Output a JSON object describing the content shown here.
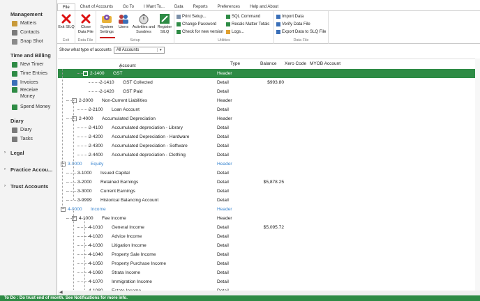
{
  "sidebar": {
    "sections": [
      {
        "title": "Management",
        "expanded": true,
        "items": [
          {
            "label": "Matters",
            "icon": "folder-icon"
          },
          {
            "label": "Contacts",
            "icon": "contacts-icon"
          },
          {
            "label": "Snap Shot",
            "icon": "camera-icon"
          }
        ]
      },
      {
        "title": "Time and Billing",
        "expanded": true,
        "items": [
          {
            "label": "New Timer",
            "icon": "timer-icon"
          },
          {
            "label": "Time Entries",
            "icon": "clock-icon"
          },
          {
            "label": "Invoices",
            "icon": "invoice-icon"
          },
          {
            "label": "Receive Money",
            "icon": "receive-money-icon"
          },
          {
            "label": "Spend Money",
            "icon": "spend-money-icon"
          }
        ]
      },
      {
        "title": "Diary",
        "expanded": true,
        "items": [
          {
            "label": "Diary",
            "icon": "diary-icon"
          },
          {
            "label": "Tasks",
            "icon": "tasks-icon"
          }
        ]
      },
      {
        "title": "Legal",
        "expanded": false,
        "items": []
      },
      {
        "title": "Practice Accou...",
        "expanded": false,
        "items": []
      },
      {
        "title": "Trust Accounts",
        "expanded": false,
        "items": []
      }
    ]
  },
  "ribbon": {
    "tabs": [
      "File",
      "Chart of Accounts",
      "Go To",
      "I Want To...",
      "Data",
      "Reports",
      "Preferences",
      "Help and About"
    ],
    "active_tab": "File",
    "groups": {
      "exit": {
        "label": "Exit",
        "button": "Exit SILQ"
      },
      "data_file": {
        "label": "Data File",
        "button": "Close Data File"
      },
      "setup": {
        "label": "Setup",
        "buttons": [
          "System Settings",
          "Users",
          "Activities and Sundries",
          "Register SILQ"
        ]
      },
      "utilities": {
        "label": "Utilities",
        "buttons": [
          "Print Setup...",
          "Change Password",
          "Check for new version",
          "SQL Command",
          "Recalc Matter Totals",
          "Logs..."
        ]
      },
      "data_file2": {
        "label": "Data File",
        "buttons": [
          "Import Data",
          "Verify Data File",
          "Export Data to SLQ File"
        ]
      }
    }
  },
  "filter": {
    "label": "Show what type of accounts",
    "selected": "All Accounts"
  },
  "table": {
    "columns": [
      "Account Name",
      "Type",
      "Balance",
      "Xero Code",
      "MYOB Account"
    ],
    "rows": [
      {
        "code": "2-1400",
        "name": "GST",
        "type": "Header",
        "balance": "",
        "level": 2,
        "expander": true,
        "selected": true
      },
      {
        "code": "2-1410",
        "name": "GST Collected",
        "type": "Detail",
        "balance": "$993.80",
        "level": 3
      },
      {
        "code": "2-1420",
        "name": "GST Paid",
        "type": "Detail",
        "balance": "",
        "level": 3
      },
      {
        "code": "2-2000",
        "name": "Non-Current Liabilities",
        "type": "Header",
        "balance": "",
        "level": 1,
        "expander": true
      },
      {
        "code": "2-2100",
        "name": "Loan Account",
        "type": "Detail",
        "balance": "",
        "level": 2
      },
      {
        "code": "2-4000",
        "name": "Accumulated Depreciation",
        "type": "Header",
        "balance": "",
        "level": 1,
        "expander": true
      },
      {
        "code": "2-4100",
        "name": "Accumulated depreciation - Library",
        "type": "Detail",
        "balance": "",
        "level": 2
      },
      {
        "code": "2-4200",
        "name": "Accumulated Depreciation - Hardware",
        "type": "Detail",
        "balance": "",
        "level": 2
      },
      {
        "code": "2-4300",
        "name": "Accumulated Depreciation - Software",
        "type": "Detail",
        "balance": "",
        "level": 2
      },
      {
        "code": "2-4400",
        "name": "Accumulated depreciation  - Clothing",
        "type": "Detail",
        "balance": "",
        "level": 2
      },
      {
        "code": "3-0000",
        "name": "Equity",
        "type": "Header",
        "balance": "",
        "level": 0,
        "expander": true,
        "blue": true
      },
      {
        "code": "3-1000",
        "name": "Issued Capital",
        "type": "Detail",
        "balance": "",
        "level": 1
      },
      {
        "code": "3-2000",
        "name": "Retained Earnings",
        "type": "Detail",
        "balance": "$5,878.25",
        "level": 1
      },
      {
        "code": "3-3000",
        "name": "Current Earnings",
        "type": "Detail",
        "balance": "",
        "level": 1
      },
      {
        "code": "3-9999",
        "name": "Historical Balancing Account",
        "type": "Detail",
        "balance": "",
        "level": 1
      },
      {
        "code": "4-0000",
        "name": "Income",
        "type": "Header",
        "balance": "",
        "level": 0,
        "expander": true,
        "blue": true
      },
      {
        "code": "4-1000",
        "name": "Fee Income",
        "type": "Header",
        "balance": "",
        "level": 1,
        "expander": true
      },
      {
        "code": "4-1010",
        "name": "General Income",
        "type": "Detail",
        "balance": "$5,095.72",
        "level": 2
      },
      {
        "code": "4-1020",
        "name": "Advice Income",
        "type": "Detail",
        "balance": "",
        "level": 2
      },
      {
        "code": "4-1030",
        "name": "Litigation Income",
        "type": "Detail",
        "balance": "",
        "level": 2
      },
      {
        "code": "4-1040",
        "name": "Property Sale Income",
        "type": "Detail",
        "balance": "",
        "level": 2
      },
      {
        "code": "4-1050",
        "name": "Property Purchase Income",
        "type": "Detail",
        "balance": "",
        "level": 2
      },
      {
        "code": "4-1060",
        "name": "Strata Income",
        "type": "Detail",
        "balance": "",
        "level": 2
      },
      {
        "code": "4-1070",
        "name": "Immigration Income",
        "type": "Detail",
        "balance": "",
        "level": 2
      },
      {
        "code": "4-1080",
        "name": "Estate Income",
        "type": "Detail",
        "balance": "",
        "level": 2
      }
    ]
  },
  "status_bar": {
    "text": "To Do : Do trust end of month. See Notifications for more info."
  },
  "colors": {
    "accent": "#2e8b45",
    "link_blue": "#3a86d0",
    "danger": "#c00000"
  }
}
